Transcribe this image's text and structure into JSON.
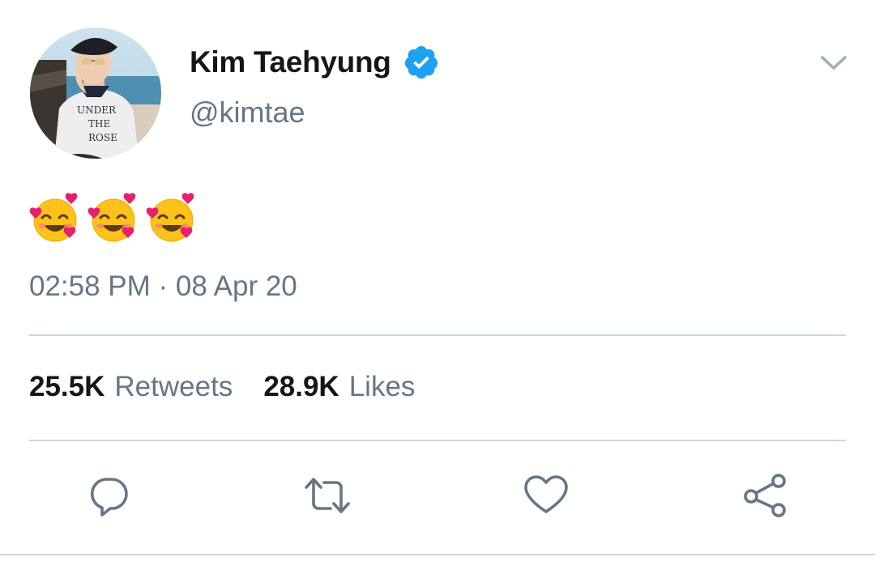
{
  "author": {
    "display_name": "Kim Taehyung",
    "handle": "@kimtae",
    "verified": true,
    "avatar_text": [
      "UNDER",
      "THE",
      "ROSE"
    ]
  },
  "tweet": {
    "text": "🥰🥰🥰",
    "timestamp": "02:58 PM · 08 Apr 20"
  },
  "stats": {
    "retweets_count": "25.5K",
    "retweets_label": "Retweets",
    "likes_count": "28.9K",
    "likes_label": "Likes"
  },
  "icons": {
    "verified": "verified-badge-icon",
    "menu": "chevron-down-icon",
    "reply": "reply-icon",
    "retweet": "retweet-icon",
    "like": "heart-icon",
    "share": "share-icon"
  },
  "colors": {
    "text_primary": "#14171a",
    "text_secondary": "#657786",
    "divider": "#ccd6dd",
    "verified_blue": "#1da1f2"
  }
}
